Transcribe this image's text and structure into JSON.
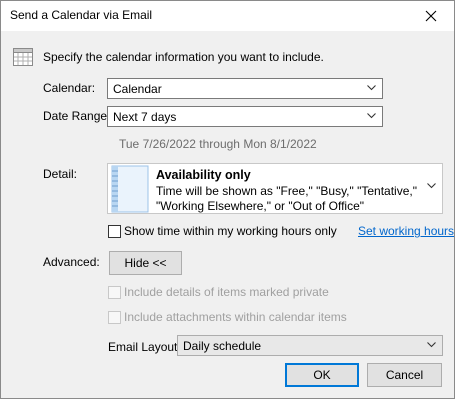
{
  "window": {
    "title": "Send a Calendar via Email"
  },
  "intro": "Specify the calendar information you want to include.",
  "calendar": {
    "label": "Calendar:",
    "value": "Calendar"
  },
  "date_range": {
    "label": "Date Range:",
    "value": "Next 7 days",
    "summary": "Tue 7/26/2022 through Mon 8/1/2022"
  },
  "detail": {
    "label": "Detail:",
    "title": "Availability only",
    "description": "Time will be shown as \"Free,\" \"Busy,\" \"Tentative,\" \"Working Elsewhere,\" or \"Out of Office\""
  },
  "working_hours": {
    "checkbox_label": "Show time within my working hours only",
    "checked": false,
    "link": "Set working hours"
  },
  "advanced": {
    "label": "Advanced:",
    "button": "Hide <<"
  },
  "options": {
    "private": "Include details of items marked private",
    "attachments": "Include attachments within calendar items"
  },
  "email_layout": {
    "label": "Email Layout:",
    "value": "Daily schedule"
  },
  "footer": {
    "ok": "OK",
    "cancel": "Cancel"
  },
  "colors": {
    "link": "#0066cc",
    "accent": "#0078d7",
    "disabled": "#a0a0a0"
  }
}
